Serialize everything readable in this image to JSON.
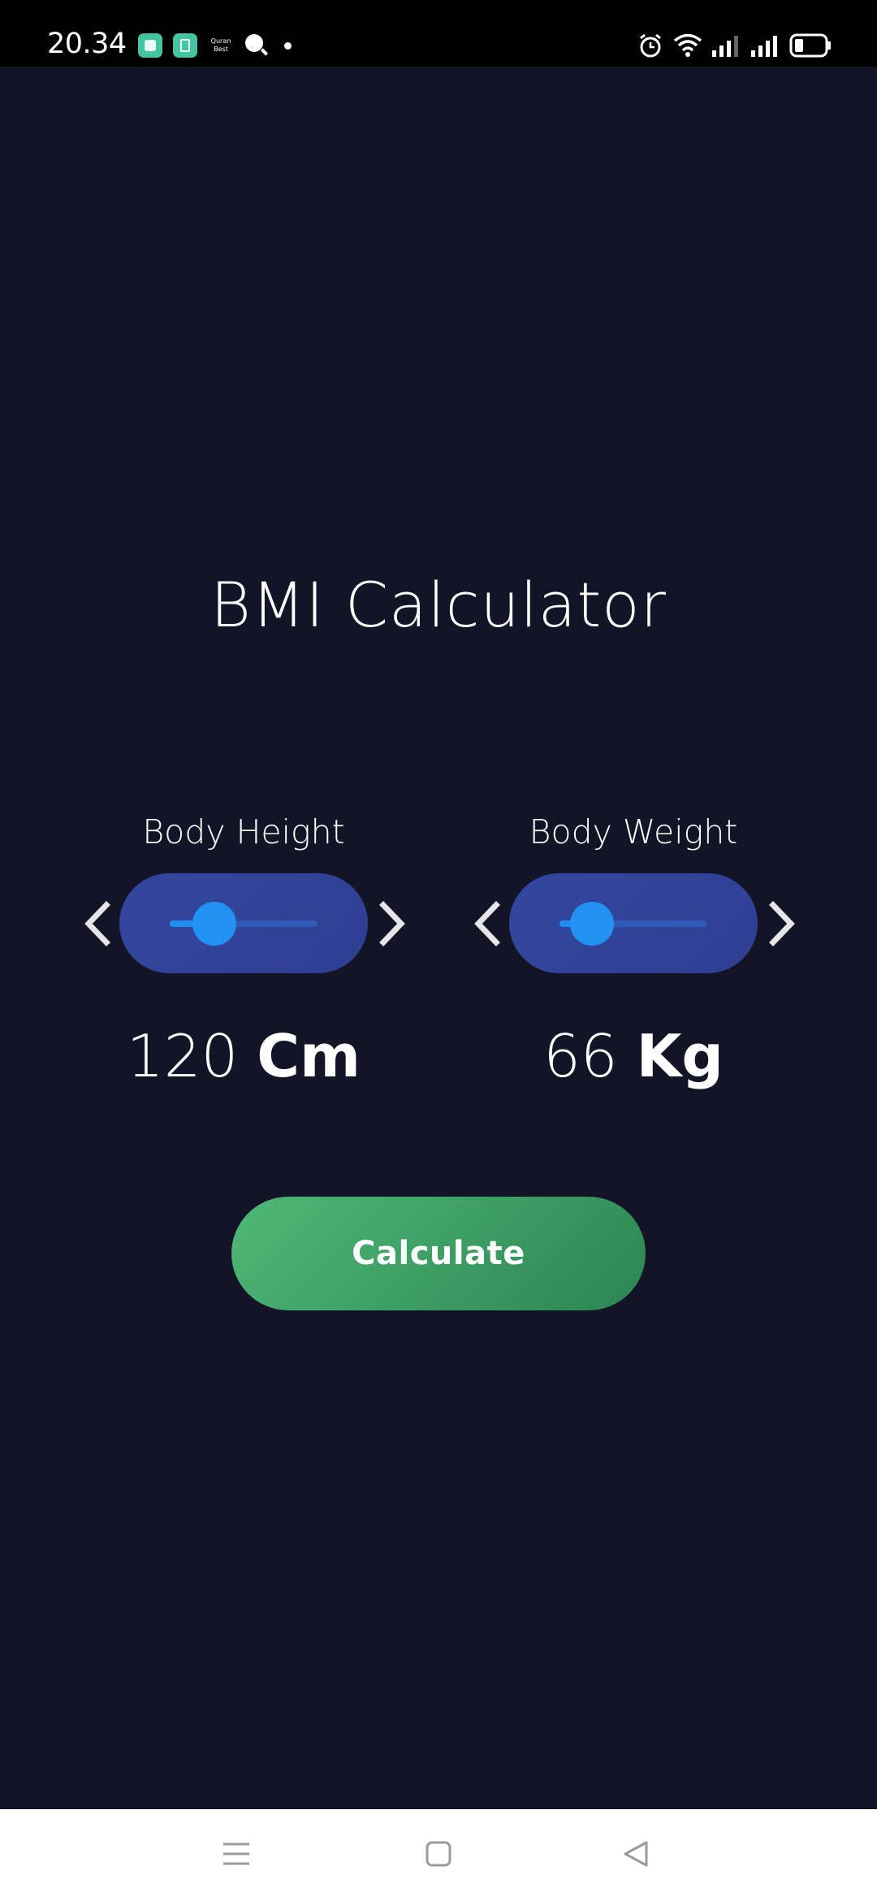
{
  "status_bar": {
    "time": "20.34",
    "quran_app_label": "Quran Best",
    "icons": [
      "app-icon",
      "app-icon",
      "quran-best-icon",
      "search-icon",
      "dot-icon",
      "alarm-icon",
      "wifi-icon",
      "signal-icon",
      "signal-icon",
      "battery-icon"
    ]
  },
  "title": "BMI Calculator",
  "height": {
    "label": "Body Height",
    "value": "120",
    "unit": "Cm",
    "slider_fraction": 0.3
  },
  "weight": {
    "label": "Body Weight",
    "value": "66",
    "unit": "Kg",
    "slider_fraction": 0.22
  },
  "calculate_button": {
    "label": "Calculate"
  },
  "nav_bar": {
    "icons": [
      "menu-icon",
      "home-icon",
      "back-icon"
    ]
  },
  "colors": {
    "background": "#131425",
    "pill": "#34479f",
    "slider_thumb": "#2192f2",
    "button": "#3e9e63"
  }
}
